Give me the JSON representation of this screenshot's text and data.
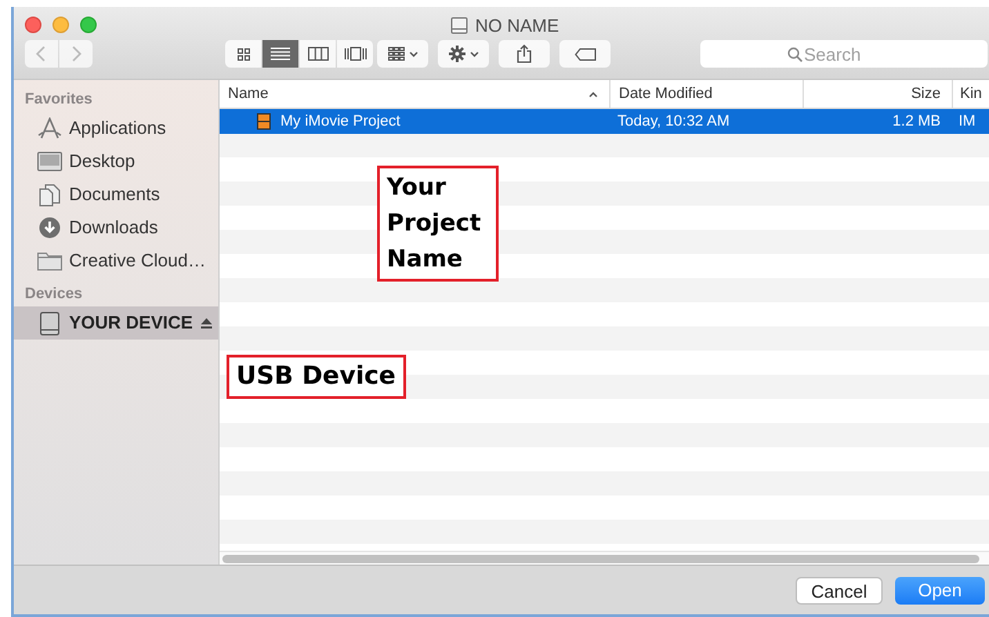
{
  "window": {
    "title": "NO NAME"
  },
  "toolbar": {
    "view_modes": [
      {
        "kind": "icons",
        "selected": false
      },
      {
        "kind": "list",
        "selected": true
      },
      {
        "kind": "columns",
        "selected": false
      },
      {
        "kind": "coverflow",
        "selected": false
      }
    ],
    "search": {
      "placeholder": "Search"
    }
  },
  "sidebar": {
    "sections": [
      {
        "title": "Favorites",
        "items": [
          {
            "kind": "applications",
            "label": "Applications",
            "selected": false,
            "ejectable": false
          },
          {
            "kind": "desktop",
            "label": "Desktop",
            "selected": false,
            "ejectable": false
          },
          {
            "kind": "documents",
            "label": "Documents",
            "selected": false,
            "ejectable": false
          },
          {
            "kind": "downloads",
            "label": "Downloads",
            "selected": false,
            "ejectable": false
          },
          {
            "kind": "folder",
            "label": "Creative Cloud…",
            "selected": false,
            "ejectable": false
          }
        ]
      },
      {
        "title": "Devices",
        "items": [
          {
            "kind": "drive",
            "label": "YOUR DEVICE",
            "selected": true,
            "ejectable": true
          }
        ]
      }
    ]
  },
  "table": {
    "columns": [
      {
        "label": "Name",
        "sorted": true
      },
      {
        "label": "Date Modified",
        "sorted": false
      },
      {
        "label": "Size",
        "sorted": false
      },
      {
        "label": "Kin",
        "sorted": false
      }
    ],
    "rows": [
      {
        "name": "My iMovie Project",
        "date": "Today, 10:32 AM",
        "size": "1.2 MB",
        "kind": "IM",
        "selected": true
      }
    ]
  },
  "annotations": [
    {
      "text": "Your Project Name"
    },
    {
      "text": "USB Device"
    }
  ],
  "buttons": [
    {
      "label": "Cancel",
      "kind": "secondary"
    },
    {
      "label": "Open",
      "kind": "primary"
    }
  ]
}
